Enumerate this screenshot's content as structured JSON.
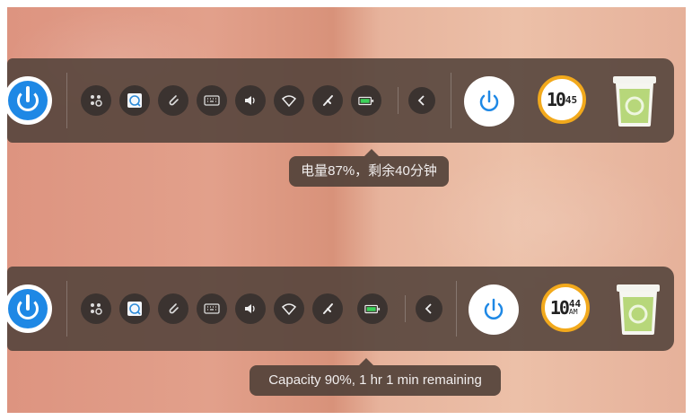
{
  "docks": [
    {
      "tray_icons": [
        "multitasking-icon",
        "screenshot-icon",
        "attachment-icon",
        "keyboard-icon",
        "volume-icon",
        "wifi-icon",
        "bluetooth-icon",
        "battery-icon",
        "chevron-left-icon"
      ],
      "clock": {
        "hours": "10",
        "minutes": "45",
        "ampm": ""
      },
      "battery_tooltip": "电量87%，剩余40分钟"
    },
    {
      "tray_icons": [
        "multitasking-icon",
        "screenshot-icon",
        "attachment-icon",
        "keyboard-icon",
        "volume-icon",
        "wifi-icon",
        "bluetooth-icon",
        "battery-icon",
        "chevron-left-icon"
      ],
      "clock": {
        "hours": "10",
        "minutes": "44",
        "ampm": "AM"
      },
      "battery_tooltip": "Capacity 90%, 1 hr 1 min remaining"
    }
  ],
  "colors": {
    "dock_bg": "#52423a",
    "launcher_blue": "#1e88e5",
    "power_blue": "#1e88e5",
    "clock_ring": "#f2a91c",
    "battery_green": "#3dd15a",
    "trash_green": "#b7d77a"
  }
}
